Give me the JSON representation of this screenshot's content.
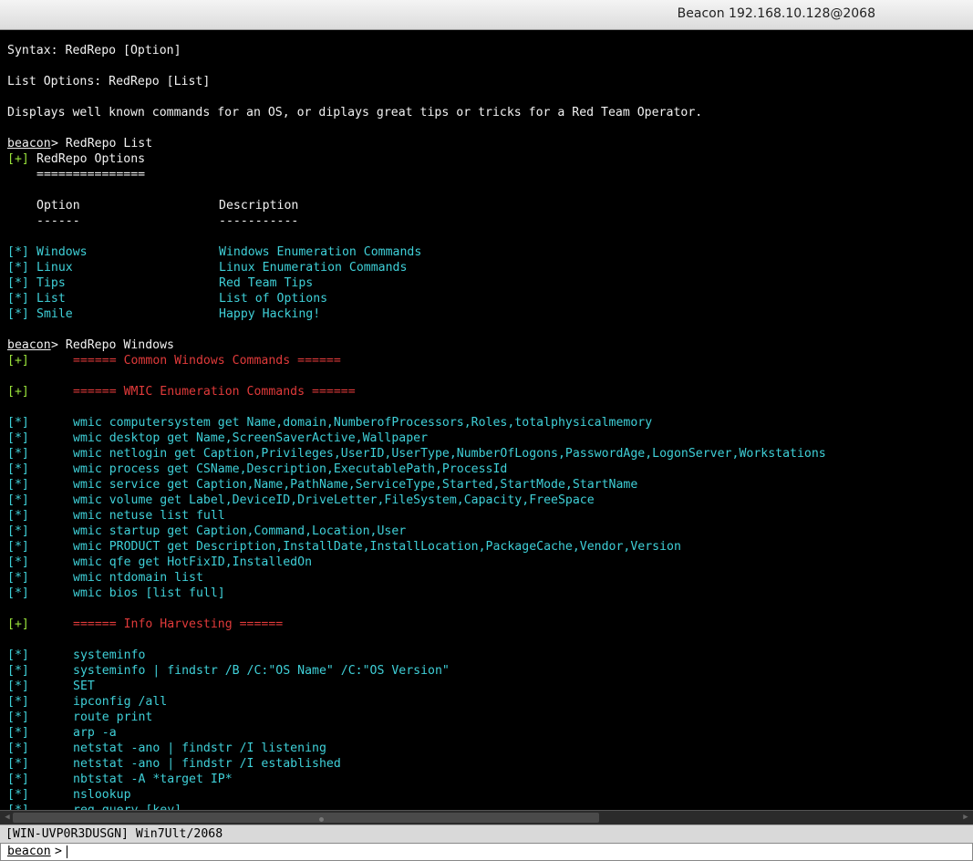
{
  "window": {
    "title": "Beacon 192.168.10.128@2068"
  },
  "console": {
    "lines": [
      {
        "segs": [
          {
            "c": "t-white",
            "t": "Syntax: RedRepo [Option]"
          }
        ]
      },
      {
        "segs": []
      },
      {
        "segs": [
          {
            "c": "t-white",
            "t": "List Options: RedRepo [List]"
          }
        ]
      },
      {
        "segs": []
      },
      {
        "segs": [
          {
            "c": "t-white",
            "t": "Displays well known commands for an OS, or diplays great tips or tricks for a Red Team Operator."
          }
        ]
      },
      {
        "segs": []
      },
      {
        "segs": [
          {
            "c": "t-white prompt",
            "t": "beacon"
          },
          {
            "c": "t-white",
            "x": 6,
            "t": "> RedRepo List"
          }
        ]
      },
      {
        "segs": [
          {
            "c": "t-green",
            "t": "[+]"
          },
          {
            "c": "t-white",
            "x": 4,
            "t": "RedRepo Options"
          }
        ]
      },
      {
        "segs": [
          {
            "c": "t-white",
            "x": 4,
            "t": "==============="
          }
        ]
      },
      {
        "segs": []
      },
      {
        "segs": [
          {
            "c": "t-white",
            "x": 4,
            "t": "Option"
          },
          {
            "c": "t-white",
            "x": 29,
            "t": "Description"
          }
        ]
      },
      {
        "segs": [
          {
            "c": "t-white",
            "x": 4,
            "t": "------"
          },
          {
            "c": "t-white",
            "x": 29,
            "t": "-----------"
          }
        ]
      },
      {
        "segs": []
      },
      {
        "segs": [
          {
            "c": "t-cyan",
            "t": "[*]"
          },
          {
            "c": "t-cyan",
            "x": 4,
            "t": "Windows"
          },
          {
            "c": "t-cyan",
            "x": 29,
            "t": "Windows Enumeration Commands"
          }
        ]
      },
      {
        "segs": [
          {
            "c": "t-cyan",
            "t": "[*]"
          },
          {
            "c": "t-cyan",
            "x": 4,
            "t": "Linux"
          },
          {
            "c": "t-cyan",
            "x": 29,
            "t": "Linux Enumeration Commands"
          }
        ]
      },
      {
        "segs": [
          {
            "c": "t-cyan",
            "t": "[*]"
          },
          {
            "c": "t-cyan",
            "x": 4,
            "t": "Tips"
          },
          {
            "c": "t-cyan",
            "x": 29,
            "t": "Red Team Tips"
          }
        ]
      },
      {
        "segs": [
          {
            "c": "t-cyan",
            "t": "[*]"
          },
          {
            "c": "t-cyan",
            "x": 4,
            "t": "List"
          },
          {
            "c": "t-cyan",
            "x": 29,
            "t": "List of Options"
          }
        ]
      },
      {
        "segs": [
          {
            "c": "t-cyan",
            "t": "[*]"
          },
          {
            "c": "t-cyan",
            "x": 4,
            "t": "Smile"
          },
          {
            "c": "t-cyan",
            "x": 29,
            "t": "Happy Hacking!"
          }
        ]
      },
      {
        "segs": []
      },
      {
        "segs": [
          {
            "c": "t-white prompt",
            "t": "beacon"
          },
          {
            "c": "t-white",
            "x": 6,
            "t": "> RedRepo Windows"
          }
        ]
      },
      {
        "segs": [
          {
            "c": "t-green",
            "t": "[+]"
          },
          {
            "c": "t-red",
            "x": 9,
            "t": "====== Common Windows Commands ======"
          }
        ]
      },
      {
        "segs": []
      },
      {
        "segs": [
          {
            "c": "t-green",
            "t": "[+]"
          },
          {
            "c": "t-red",
            "x": 9,
            "t": "====== WMIC Enumeration Commands ======"
          }
        ]
      },
      {
        "segs": []
      },
      {
        "segs": [
          {
            "c": "t-cyan",
            "t": "[*]"
          },
          {
            "c": "t-cyan",
            "x": 9,
            "t": "wmic computersystem get Name,domain,NumberofProcessors,Roles,totalphysicalmemory"
          }
        ]
      },
      {
        "segs": [
          {
            "c": "t-cyan",
            "t": "[*]"
          },
          {
            "c": "t-cyan",
            "x": 9,
            "t": "wmic desktop get Name,ScreenSaverActive,Wallpaper"
          }
        ]
      },
      {
        "segs": [
          {
            "c": "t-cyan",
            "t": "[*]"
          },
          {
            "c": "t-cyan",
            "x": 9,
            "t": "wmic netlogin get Caption,Privileges,UserID,UserType,NumberOfLogons,PasswordAge,LogonServer,Workstations"
          }
        ]
      },
      {
        "segs": [
          {
            "c": "t-cyan",
            "t": "[*]"
          },
          {
            "c": "t-cyan",
            "x": 9,
            "t": "wmic process get CSName,Description,ExecutablePath,ProcessId"
          }
        ]
      },
      {
        "segs": [
          {
            "c": "t-cyan",
            "t": "[*]"
          },
          {
            "c": "t-cyan",
            "x": 9,
            "t": "wmic service get Caption,Name,PathName,ServiceType,Started,StartMode,StartName"
          }
        ]
      },
      {
        "segs": [
          {
            "c": "t-cyan",
            "t": "[*]"
          },
          {
            "c": "t-cyan",
            "x": 9,
            "t": "wmic volume get Label,DeviceID,DriveLetter,FileSystem,Capacity,FreeSpace"
          }
        ]
      },
      {
        "segs": [
          {
            "c": "t-cyan",
            "t": "[*]"
          },
          {
            "c": "t-cyan",
            "x": 9,
            "t": "wmic netuse list full"
          }
        ]
      },
      {
        "segs": [
          {
            "c": "t-cyan",
            "t": "[*]"
          },
          {
            "c": "t-cyan",
            "x": 9,
            "t": "wmic startup get Caption,Command,Location,User"
          }
        ]
      },
      {
        "segs": [
          {
            "c": "t-cyan",
            "t": "[*]"
          },
          {
            "c": "t-cyan",
            "x": 9,
            "t": "wmic PRODUCT get Description,InstallDate,InstallLocation,PackageCache,Vendor,Version"
          }
        ]
      },
      {
        "segs": [
          {
            "c": "t-cyan",
            "t": "[*]"
          },
          {
            "c": "t-cyan",
            "x": 9,
            "t": "wmic qfe get HotFixID,InstalledOn"
          }
        ]
      },
      {
        "segs": [
          {
            "c": "t-cyan",
            "t": "[*]"
          },
          {
            "c": "t-cyan",
            "x": 9,
            "t": "wmic ntdomain list"
          }
        ]
      },
      {
        "segs": [
          {
            "c": "t-cyan",
            "t": "[*]"
          },
          {
            "c": "t-cyan",
            "x": 9,
            "t": "wmic bios [list full]"
          }
        ]
      },
      {
        "segs": []
      },
      {
        "segs": [
          {
            "c": "t-green",
            "t": "[+]"
          },
          {
            "c": "t-red",
            "x": 9,
            "t": "====== Info Harvesting ======"
          }
        ]
      },
      {
        "segs": []
      },
      {
        "segs": [
          {
            "c": "t-cyan",
            "t": "[*]"
          },
          {
            "c": "t-cyan",
            "x": 9,
            "t": "systeminfo"
          }
        ]
      },
      {
        "segs": [
          {
            "c": "t-cyan",
            "t": "[*]"
          },
          {
            "c": "t-cyan",
            "x": 9,
            "t": "systeminfo | findstr /B /C:\"OS Name\" /C:\"OS Version\""
          }
        ]
      },
      {
        "segs": [
          {
            "c": "t-cyan",
            "t": "[*]"
          },
          {
            "c": "t-cyan",
            "x": 9,
            "t": "SET"
          }
        ]
      },
      {
        "segs": [
          {
            "c": "t-cyan",
            "t": "[*]"
          },
          {
            "c": "t-cyan",
            "x": 9,
            "t": "ipconfig /all"
          }
        ]
      },
      {
        "segs": [
          {
            "c": "t-cyan",
            "t": "[*]"
          },
          {
            "c": "t-cyan",
            "x": 9,
            "t": "route print"
          }
        ]
      },
      {
        "segs": [
          {
            "c": "t-cyan",
            "t": "[*]"
          },
          {
            "c": "t-cyan",
            "x": 9,
            "t": "arp -a"
          }
        ]
      },
      {
        "segs": [
          {
            "c": "t-cyan",
            "t": "[*]"
          },
          {
            "c": "t-cyan",
            "x": 9,
            "t": "netstat -ano | findstr /I listening"
          }
        ]
      },
      {
        "segs": [
          {
            "c": "t-cyan",
            "t": "[*]"
          },
          {
            "c": "t-cyan",
            "x": 9,
            "t": "netstat -ano | findstr /I established"
          }
        ]
      },
      {
        "segs": [
          {
            "c": "t-cyan",
            "t": "[*]"
          },
          {
            "c": "t-cyan",
            "x": 9,
            "t": "nbtstat -A *target IP*"
          }
        ]
      },
      {
        "segs": [
          {
            "c": "t-cyan",
            "t": "[*]"
          },
          {
            "c": "t-cyan",
            "x": 9,
            "t": "nslookup"
          }
        ]
      },
      {
        "segs": [
          {
            "c": "t-cyan",
            "t": "[*]"
          },
          {
            "c": "t-cyan",
            "x": 9,
            "t": "reg query [key]"
          }
        ]
      }
    ]
  },
  "statusbar": {
    "text": "[WIN-UVP0R3DUSGN] Win7Ult/2068"
  },
  "input": {
    "prompt": "beacon",
    "symbol": ">",
    "value": ""
  }
}
